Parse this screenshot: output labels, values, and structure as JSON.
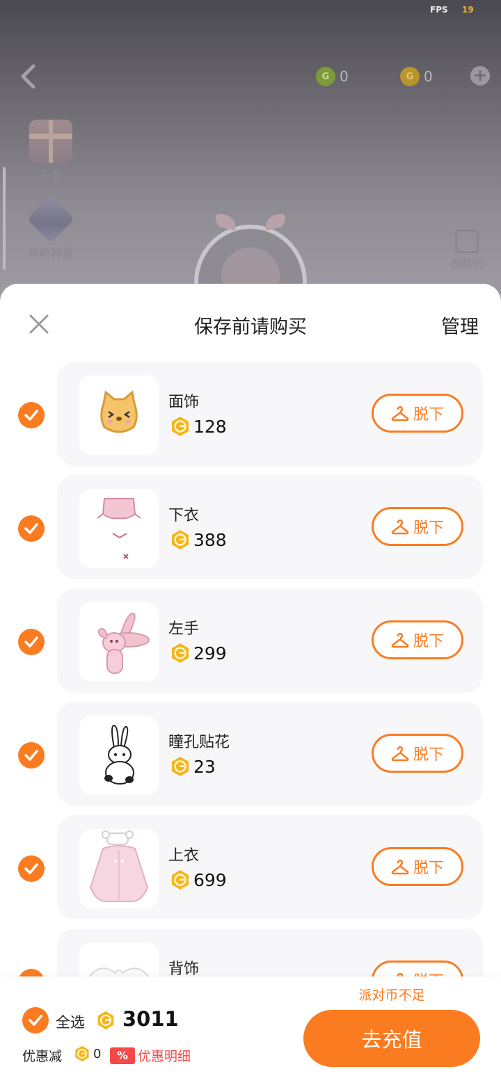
{
  "hud": {
    "fps_label": "FPS",
    "fps_value": "19"
  },
  "top_bar": {
    "currency_green": "0",
    "currency_gold": "0"
  },
  "side_menu": [
    {
      "label": "盲盒",
      "icon": "gift-box-icon"
    },
    {
      "label": "萌新特惠",
      "icon": "newbie-deal-icon"
    }
  ],
  "face_button": {
    "label": "捏脸码"
  },
  "sheet": {
    "title": "保存前请购买",
    "manage_label": "管理",
    "items": [
      {
        "name": "面饰",
        "price": "128",
        "action": "脱下",
        "checked": true,
        "icon": "cat-mask-icon"
      },
      {
        "name": "下衣",
        "price": "388",
        "action": "脱下",
        "checked": true,
        "icon": "pink-shorts-icon"
      },
      {
        "name": "左手",
        "price": "299",
        "action": "脱下",
        "checked": true,
        "icon": "bunny-plush-icon"
      },
      {
        "name": "瞳孔贴花",
        "price": "23",
        "action": "脱下",
        "checked": true,
        "icon": "bunny-sticker-icon"
      },
      {
        "name": "上衣",
        "price": "699",
        "action": "脱下",
        "checked": true,
        "icon": "pink-coat-icon"
      },
      {
        "name": "背饰",
        "price": "",
        "action": "脱下",
        "checked": true,
        "icon": "wings-icon"
      }
    ]
  },
  "footer": {
    "select_all_label": "全选",
    "total": "3011",
    "discount_label": "优惠减",
    "discount_value": "0",
    "discount_badge": "%",
    "discount_detail_label": "优惠明细",
    "insufficient_label": "派对币不足",
    "recharge_label": "去充值"
  },
  "colors": {
    "accent": "#fb7b21",
    "coin": "#f4b51c",
    "discount_red": "#f54848"
  }
}
